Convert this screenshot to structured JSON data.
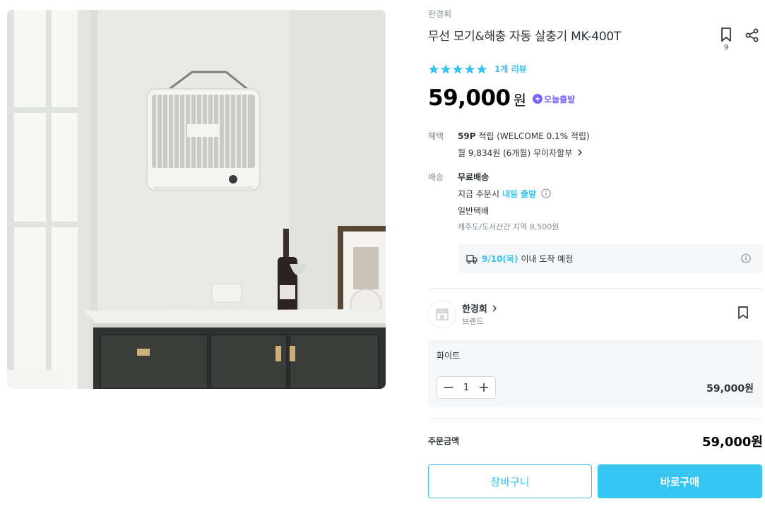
{
  "product": {
    "brand": "한경희",
    "title": "무선 모기&해충 자동 살충기 MK-400T",
    "bookmark_count": "9",
    "rating_stars": 5,
    "review_link": "1개 리뷰",
    "price": "59,000",
    "currency": "원",
    "today_badge": "오늘출발"
  },
  "benefit": {
    "label": "혜택",
    "points": "59P",
    "points_desc": "적립 (WELCOME 0.1% 적립)",
    "installment": "월 9,834원 (6개월) 무이자할부"
  },
  "shipping": {
    "label": "배송",
    "type": "무료배송",
    "order_now": "지금 주문시",
    "dispatch": "내일 출발",
    "carrier": "일반택배",
    "extra_fee": "제주도/도서산간 지역 8,500원",
    "arrival_date": "9/10(목)",
    "arrival_suffix": "이내 도착 예정"
  },
  "seller": {
    "name": "한경희",
    "type": "브랜드"
  },
  "option": {
    "name": "화이트",
    "quantity": "1",
    "price": "59,000원"
  },
  "order": {
    "label": "주문금액",
    "total": "59,000원"
  },
  "actions": {
    "cart_label": "장바구니",
    "buy_label": "바로구매"
  },
  "colors": {
    "accent": "#35c5f0",
    "badge_purple": "#7b61ff",
    "text": "#2f3438",
    "muted": "#828c94"
  },
  "icons": [
    "bookmark-icon",
    "share-icon",
    "star-icon",
    "lightning-icon",
    "chevron-right-icon",
    "info-icon",
    "truck-icon",
    "minus-icon",
    "plus-icon"
  ]
}
